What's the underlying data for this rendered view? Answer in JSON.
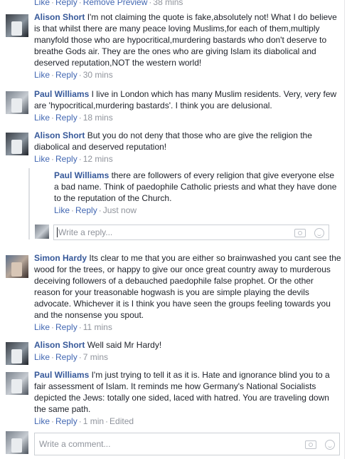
{
  "top_actions": {
    "like": "Like",
    "reply": "Reply",
    "remove_preview": "Remove Preview",
    "time": "38 mins"
  },
  "comments": [
    {
      "name": "Alison Short",
      "text": "I'm not claiming the quote is fake,absolutely not! What I do believe is that whilst there are many peace loving Muslims,for each of them,multiply manyfold those who are hypocritical,murdering bastards who don't deserve to breathe Gods air. They are the ones who are giving Islam its diabolical and deserved reputation,NOT the western world!",
      "like": "Like",
      "reply": "Reply",
      "time": "30 mins"
    },
    {
      "name": "Paul Williams",
      "text": "I live in London which has many Muslim residents. Very, very few are 'hypocritical,murdering bastards'. I think you are delusional.",
      "like": "Like",
      "reply": "Reply",
      "time": "18 mins"
    },
    {
      "name": "Alison Short",
      "text": "But you do not deny that those who are give the religion the diabolical and deserved reputation!",
      "like": "Like",
      "reply": "Reply",
      "time": "12 mins"
    },
    {
      "name": "Paul Williams",
      "text": "there are followers of every religion that give everyone else a bad name. Think of paedophile Catholic priests and what they have done to the reputation of the Church.",
      "like": "Like",
      "reply": "Reply",
      "time": "Just now"
    },
    {
      "name": "Simon Hardy",
      "text": "Its clear to me that you are either so brainwashed you cant see the wood for the trees, or happy to give our once great country away to murderous deceiving followers of a debauched paedophile false prophet. Or the other reason for your treasonable hogwash is you are simple playing the devils advocate. Whichever it is I think you have seen the groups feeling towards you and the nonsense you spout.",
      "like": "Like",
      "reply": "Reply",
      "time": "11 mins"
    },
    {
      "name": "Alison Short",
      "text": "Well said Mr Hardy!",
      "like": "Like",
      "reply": "Reply",
      "time": "7 mins"
    },
    {
      "name": "Paul Williams",
      "text": "I'm just trying to tell it as it is. Hate and ignorance blind you to a fair assessment of Islam. It reminds me how Germany's National Socialists depicted the Jews: totally one sided, laced with hatred. You are traveling down the same path.",
      "like": "Like",
      "reply": "Reply",
      "time": "1 min",
      "edited": "Edited"
    }
  ],
  "reply_box": {
    "placeholder": "Write a reply..."
  },
  "comment_box": {
    "placeholder": "Write a comment..."
  }
}
